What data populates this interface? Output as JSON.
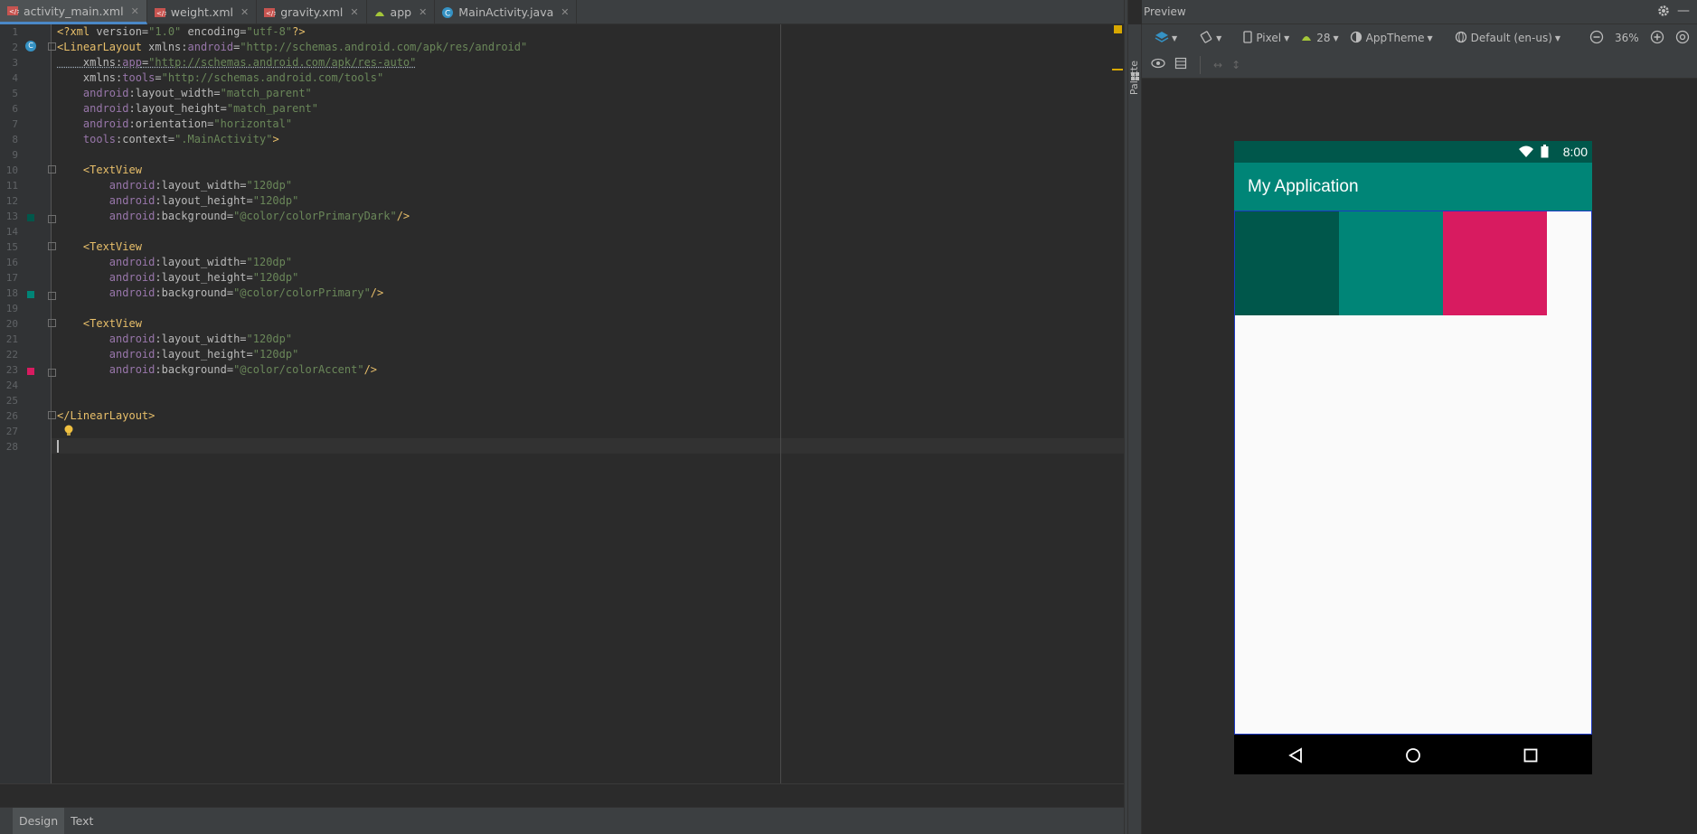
{
  "tabs": [
    {
      "label": "activity_main.xml",
      "icon": "xml-layout-icon",
      "active": true
    },
    {
      "label": "weight.xml",
      "icon": "xml-layout-icon",
      "active": false
    },
    {
      "label": "gravity.xml",
      "icon": "xml-layout-icon",
      "active": false
    },
    {
      "label": "app",
      "icon": "android-module-icon",
      "active": false
    },
    {
      "label": "MainActivity.java",
      "icon": "java-class-icon",
      "active": false
    }
  ],
  "code_lines": [
    {
      "num": "1",
      "parts": [
        [
          "tag",
          "<?xml "
        ],
        [
          "attr",
          "version="
        ],
        [
          "val",
          "\"1.0\""
        ],
        [
          "attr",
          " encoding="
        ],
        [
          "val",
          "\"utf-8\""
        ],
        [
          "tag",
          "?>"
        ]
      ]
    },
    {
      "num": "2",
      "parts": [
        [
          "tag",
          "<LinearLayout "
        ],
        [
          "attr",
          "xmlns:"
        ],
        [
          "attrns",
          "android"
        ],
        [
          "attr",
          "="
        ],
        [
          "val",
          "\"http://schemas.android.com/apk/res/android\""
        ]
      ]
    },
    {
      "num": "3",
      "parts": [
        [
          "attr",
          "    xmlns:"
        ],
        [
          "attrns",
          "app"
        ],
        [
          "attr",
          "="
        ],
        [
          "val",
          "\"http://schemas.android.com/apk/res-auto\""
        ]
      ]
    },
    {
      "num": "4",
      "parts": [
        [
          "attr",
          "    xmlns:"
        ],
        [
          "attrns",
          "tools"
        ],
        [
          "attr",
          "="
        ],
        [
          "val",
          "\"http://schemas.android.com/tools\""
        ]
      ]
    },
    {
      "num": "5",
      "parts": [
        [
          "attrns",
          "    android"
        ],
        [
          "attr",
          ":layout_width="
        ],
        [
          "val",
          "\"match_parent\""
        ]
      ]
    },
    {
      "num": "6",
      "parts": [
        [
          "attrns",
          "    android"
        ],
        [
          "attr",
          ":layout_height="
        ],
        [
          "val",
          "\"match_parent\""
        ]
      ]
    },
    {
      "num": "7",
      "parts": [
        [
          "attrns",
          "    android"
        ],
        [
          "attr",
          ":orientation="
        ],
        [
          "val",
          "\"horizontal\""
        ]
      ]
    },
    {
      "num": "8",
      "parts": [
        [
          "attrns",
          "    tools"
        ],
        [
          "attr",
          ":context="
        ],
        [
          "val",
          "\".MainActivity\""
        ],
        [
          "tag",
          ">"
        ]
      ]
    },
    {
      "num": "9",
      "parts": []
    },
    {
      "num": "10",
      "parts": [
        [
          "tag",
          "    <TextView"
        ]
      ]
    },
    {
      "num": "11",
      "parts": [
        [
          "attrns",
          "        android"
        ],
        [
          "attr",
          ":layout_width="
        ],
        [
          "val",
          "\"120dp\""
        ]
      ]
    },
    {
      "num": "12",
      "parts": [
        [
          "attrns",
          "        android"
        ],
        [
          "attr",
          ":layout_height="
        ],
        [
          "val",
          "\"120dp\""
        ]
      ]
    },
    {
      "num": "13",
      "parts": [
        [
          "attrns",
          "        android"
        ],
        [
          "attr",
          ":background="
        ],
        [
          "val",
          "\"@color/colorPrimaryDark\""
        ],
        [
          "tag",
          "/>"
        ]
      ]
    },
    {
      "num": "14",
      "parts": []
    },
    {
      "num": "15",
      "parts": [
        [
          "tag",
          "    <TextView"
        ]
      ]
    },
    {
      "num": "16",
      "parts": [
        [
          "attrns",
          "        android"
        ],
        [
          "attr",
          ":layout_width="
        ],
        [
          "val",
          "\"120dp\""
        ]
      ]
    },
    {
      "num": "17",
      "parts": [
        [
          "attrns",
          "        android"
        ],
        [
          "attr",
          ":layout_height="
        ],
        [
          "val",
          "\"120dp\""
        ]
      ]
    },
    {
      "num": "18",
      "parts": [
        [
          "attrns",
          "        android"
        ],
        [
          "attr",
          ":background="
        ],
        [
          "val",
          "\"@color/colorPrimary\""
        ],
        [
          "tag",
          "/>"
        ]
      ]
    },
    {
      "num": "19",
      "parts": []
    },
    {
      "num": "20",
      "parts": [
        [
          "tag",
          "    <TextView"
        ]
      ]
    },
    {
      "num": "21",
      "parts": [
        [
          "attrns",
          "        android"
        ],
        [
          "attr",
          ":layout_width="
        ],
        [
          "val",
          "\"120dp\""
        ]
      ]
    },
    {
      "num": "22",
      "parts": [
        [
          "attrns",
          "        android"
        ],
        [
          "attr",
          ":layout_height="
        ],
        [
          "val",
          "\"120dp\""
        ]
      ]
    },
    {
      "num": "23",
      "parts": [
        [
          "attrns",
          "        android"
        ],
        [
          "attr",
          ":background="
        ],
        [
          "val",
          "\"@color/colorAccent\""
        ],
        [
          "tag",
          "/>"
        ]
      ]
    },
    {
      "num": "24",
      "parts": []
    },
    {
      "num": "25",
      "parts": []
    },
    {
      "num": "26",
      "parts": [
        [
          "tag",
          "</LinearLayout>"
        ]
      ]
    },
    {
      "num": "27",
      "parts": []
    },
    {
      "num": "28",
      "parts": []
    }
  ],
  "bottom_tabs": {
    "design": "Design",
    "text": "Text"
  },
  "preview": {
    "title": "Preview",
    "palette_label": "Palette",
    "device": "Pixel",
    "api": "28",
    "theme": "AppTheme",
    "locale": "Default (en-us)",
    "zoom": "36%"
  },
  "phone": {
    "time": "8:00",
    "app_title": "My Application"
  },
  "colors": {
    "colorPrimaryDark": "#00574b",
    "colorPrimary": "#008577",
    "colorAccent": "#d81b60"
  }
}
